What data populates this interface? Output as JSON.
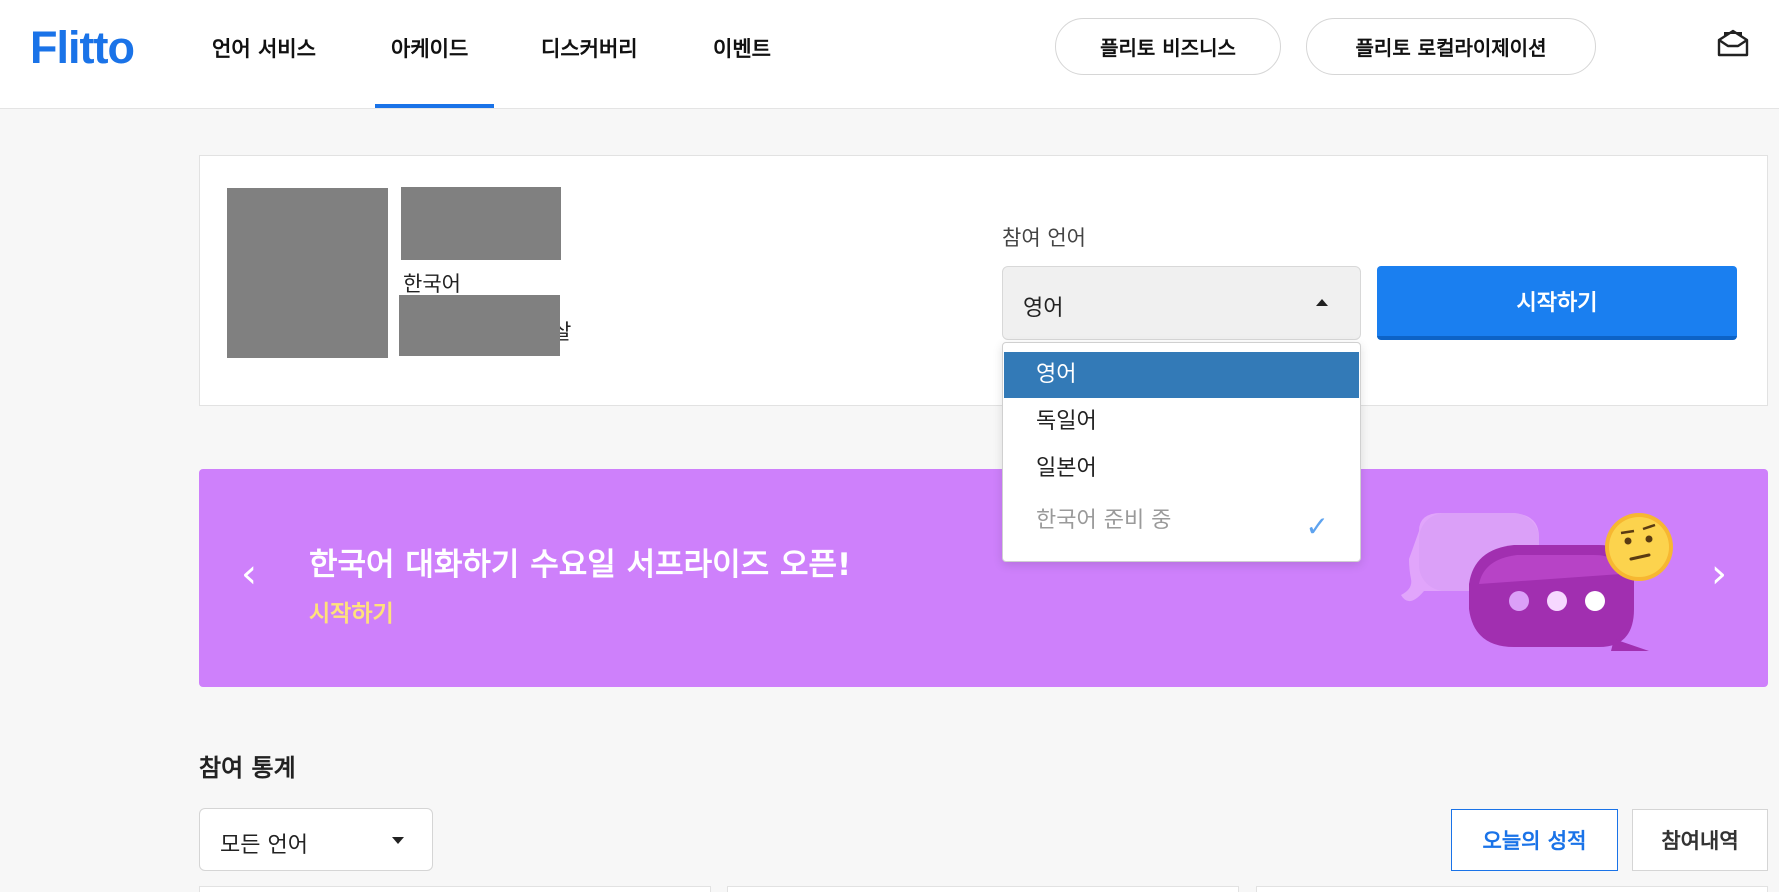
{
  "header": {
    "logo": "Flitto",
    "nav": [
      "언어 서비스",
      "아케이드",
      "디스커버리",
      "이벤트"
    ],
    "active_nav": "아케이드",
    "business_button": "플리토 비즈니스",
    "localization_button": "플리토 로컬라이제이션",
    "inbox_icon": "inbox-icon"
  },
  "profile": {
    "language": "한국어",
    "tail_text": "살"
  },
  "language_select": {
    "label": "참여 언어",
    "selected": "영어",
    "start_button": "시작하기",
    "options": [
      {
        "label": "영어",
        "state": "selected"
      },
      {
        "label": "독일어",
        "state": "normal"
      },
      {
        "label": "일본어",
        "state": "normal"
      },
      {
        "label": "한국어 준비 중",
        "state": "disabled"
      }
    ],
    "check_mark": "✓"
  },
  "banner": {
    "title": "한국어 대화하기 수요일 서프라이즈 오픈!",
    "link": "시작하기",
    "prev_arrow": "‹",
    "next_arrow": "›",
    "background_color": "#ce80fb",
    "link_color": "#ffe27a"
  },
  "stats": {
    "title": "참여 통계",
    "filter_value": "모든 언어",
    "tabs": [
      "오늘의 성적",
      "참여내역"
    ],
    "active_tab": "오늘의 성적"
  },
  "colors": {
    "accent": "#1a73e8",
    "start_button": "#1a7ff0",
    "dropdown_selected": "#337ab7"
  }
}
